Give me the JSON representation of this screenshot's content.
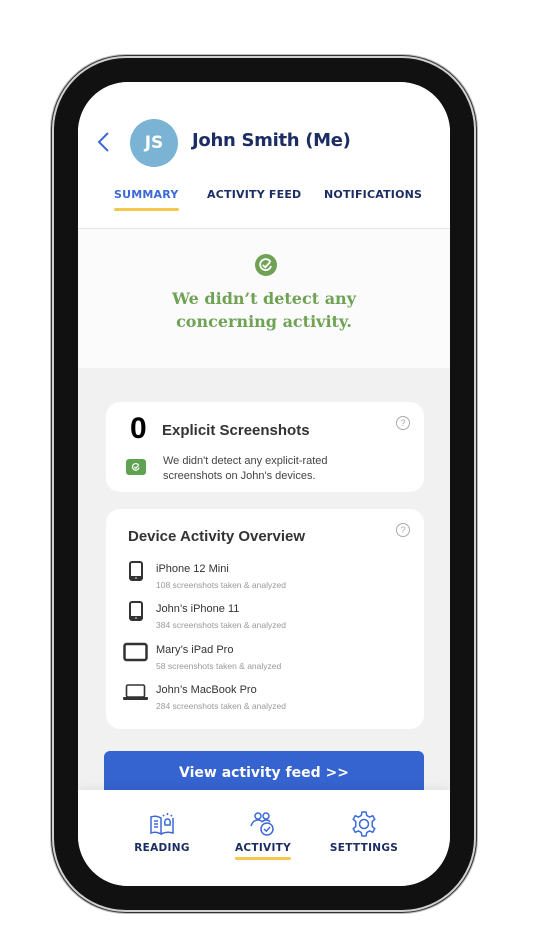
{
  "header": {
    "avatar_initials": "JS",
    "name": "John Smith (Me)",
    "tabs": [
      {
        "label": "SUMMARY",
        "active": true
      },
      {
        "label": "ACTIVITY FEED",
        "active": false
      },
      {
        "label": "NOTIFICATIONS",
        "active": false
      }
    ]
  },
  "hero": {
    "icon": "check-circle-icon",
    "line1": "We didn’t detect any",
    "line2": "concerning activity."
  },
  "explicit_card": {
    "count": "0",
    "title": "Explicit Screenshots",
    "desc_line1": "We didn't detect any explicit-rated",
    "desc_line2": "screenshots on John's devices."
  },
  "device_card": {
    "title": "Device Activity Overview",
    "devices": [
      {
        "name": "iPhone 12 Mini",
        "sub": "108 screenshots taken & analyzed",
        "icon": "phone-icon"
      },
      {
        "name": "John’s iPhone 11",
        "sub": "384 screenshots taken & analyzed",
        "icon": "phone-icon"
      },
      {
        "name": "Mary’s iPad Pro",
        "sub": "58 screenshots taken & analyzed",
        "icon": "tablet-icon"
      },
      {
        "name": "John’s MacBook Pro",
        "sub": "284 screenshots taken & analyzed",
        "icon": "laptop-icon"
      }
    ]
  },
  "cta": {
    "label": "View activity feed >>"
  },
  "bottom_nav": [
    {
      "label": "READING",
      "icon": "book-bulb-icon",
      "active": false
    },
    {
      "label": "ACTIVITY",
      "icon": "users-check-icon",
      "active": true
    },
    {
      "label": "SETTTINGS",
      "icon": "gear-icon",
      "active": false
    }
  ],
  "colors": {
    "accent": "#3563cf",
    "navy": "#1c2d63",
    "success": "#6fa254",
    "underline": "#f2c94c",
    "avatar": "#7ab3d3"
  }
}
